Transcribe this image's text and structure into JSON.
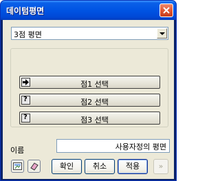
{
  "window": {
    "title": "데이텀평면"
  },
  "type_select": {
    "value": "3점 평면"
  },
  "points": [
    {
      "label": "점1 선택",
      "state": "arrow-icon"
    },
    {
      "label": "점2 선택",
      "state": "question-icon"
    },
    {
      "label": "점3 선택",
      "state": "question-icon"
    }
  ],
  "name": {
    "label": "이름",
    "value": "사용자정의 평면"
  },
  "buttons": {
    "ok": "확인",
    "cancel": "취소",
    "apply": "적용",
    "more": "»"
  },
  "colors": {
    "titlebar": "#0054e3",
    "client_bg": "#ece9d8",
    "close": "#e0542f"
  }
}
